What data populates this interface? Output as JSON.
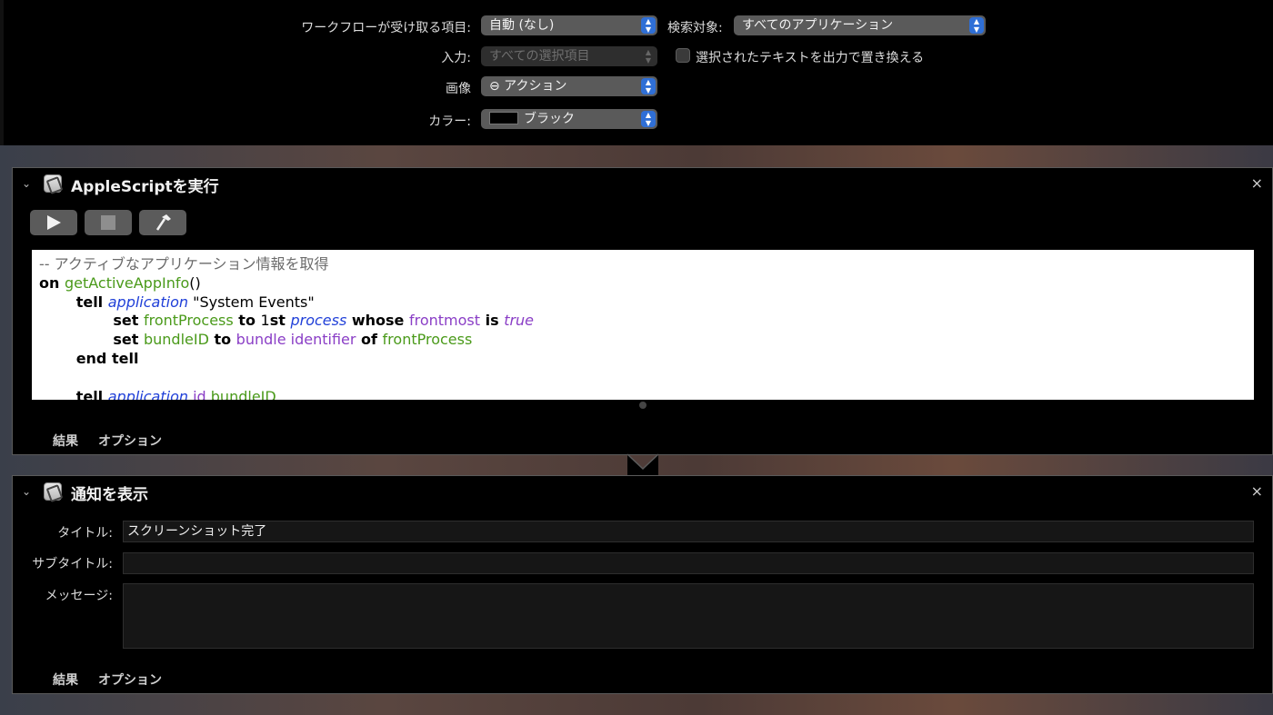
{
  "workflow": {
    "receives_label": "ワークフローが受け取る項目:",
    "receives_value": "自動 (なし)",
    "search_label": "検索対象:",
    "search_value": "すべてのアプリケーション",
    "input_label": "入力:",
    "input_value": "すべての選択項目",
    "replace_label": "選択されたテキストを出力で置き換える",
    "image_label": "画像",
    "image_value": "⊖ アクション",
    "color_label": "カラー:",
    "color_value": "ブラック",
    "color_swatch": "#000000"
  },
  "applescript": {
    "title": "AppleScriptを実行",
    "close": "×",
    "run_icon": "play-icon",
    "stop_icon": "stop-icon",
    "compile_icon": "hammer-icon",
    "code": [
      [
        {
          "c": "cmt",
          "t": "-- アクティブなアプリケーション情報を取得"
        }
      ],
      [
        {
          "c": "kw",
          "t": "on "
        },
        {
          "c": "fn",
          "t": "getActiveAppInfo"
        },
        {
          "c": "str",
          "t": "()"
        }
      ],
      [
        {
          "c": "str",
          "t": "        "
        },
        {
          "c": "kw",
          "t": "tell "
        },
        {
          "c": "app",
          "t": "application"
        },
        {
          "c": "str",
          "t": " \"System Events\""
        }
      ],
      [
        {
          "c": "str",
          "t": "                "
        },
        {
          "c": "kw",
          "t": "set "
        },
        {
          "c": "fn",
          "t": "frontProcess"
        },
        {
          "c": "kw",
          "t": " to "
        },
        {
          "c": "str",
          "t": "1"
        },
        {
          "c": "kw",
          "t": "st "
        },
        {
          "c": "app",
          "t": "process"
        },
        {
          "c": "kw",
          "t": " whose "
        },
        {
          "c": "prop",
          "t": "frontmost"
        },
        {
          "c": "kw",
          "t": " is "
        },
        {
          "c": "lit",
          "t": "true"
        }
      ],
      [
        {
          "c": "str",
          "t": "                "
        },
        {
          "c": "kw",
          "t": "set "
        },
        {
          "c": "fn",
          "t": "bundleID"
        },
        {
          "c": "kw",
          "t": " to "
        },
        {
          "c": "prop",
          "t": "bundle identifier"
        },
        {
          "c": "kw",
          "t": " of "
        },
        {
          "c": "fn",
          "t": "frontProcess"
        }
      ],
      [
        {
          "c": "str",
          "t": "        "
        },
        {
          "c": "kw",
          "t": "end tell"
        }
      ],
      [
        {
          "c": "str",
          "t": ""
        }
      ],
      [
        {
          "c": "str",
          "t": "        "
        },
        {
          "c": "kw",
          "t": "tell "
        },
        {
          "c": "app",
          "t": "application"
        },
        {
          "c": "prop",
          "t": " id"
        },
        {
          "c": "fn",
          "t": " bundleID"
        }
      ]
    ],
    "tab_results": "結果",
    "tab_options": "オプション"
  },
  "notification": {
    "title": "通知を表示",
    "close": "×",
    "title_label": "タイトル:",
    "title_value": "スクリーンショット完了",
    "subtitle_label": "サブタイトル:",
    "subtitle_value": "",
    "message_label": "メッセージ:",
    "message_value": "",
    "tab_results": "結果",
    "tab_options": "オプション"
  }
}
